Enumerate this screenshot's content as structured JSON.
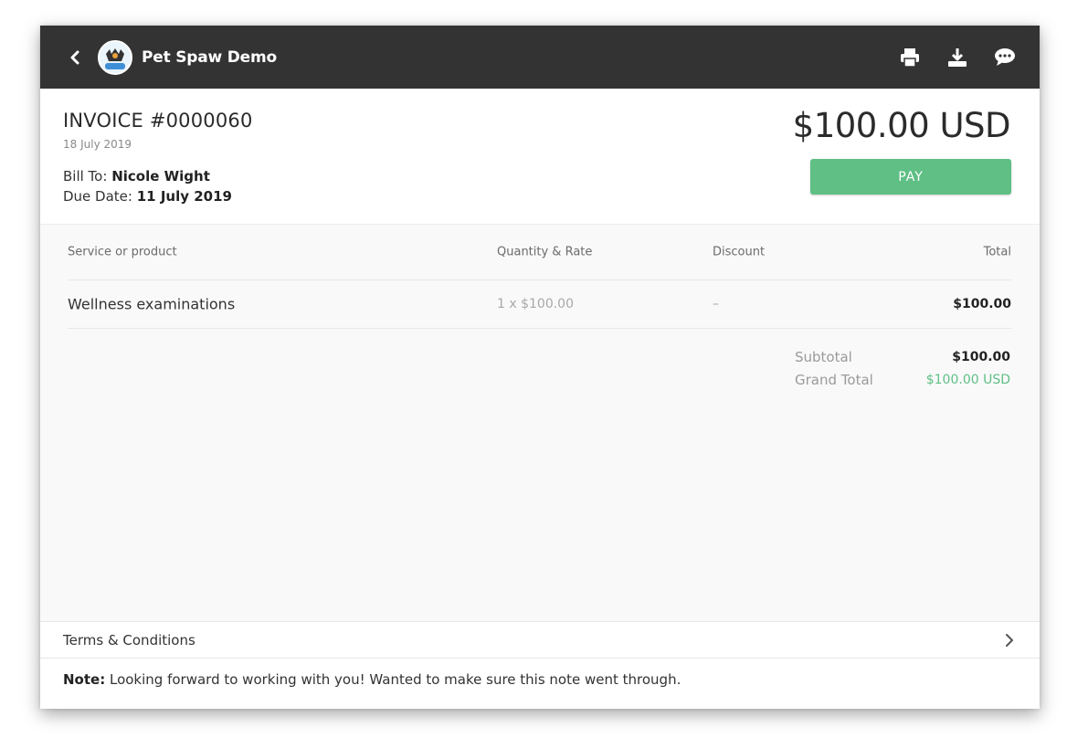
{
  "topbar": {
    "title": "Pet Spaw Demo",
    "icons": [
      "back-icon",
      "logo",
      "print-icon",
      "download-icon",
      "chat-icon"
    ]
  },
  "invoice": {
    "title": "INVOICE #0000060",
    "date": "18 July 2019",
    "bill_to_label": "Bill To:",
    "bill_to_name": "Nicole Wight",
    "due_date_label": "Due Date:",
    "due_date": "11 July 2019",
    "amount": "$100.00 USD",
    "pay_label": "PAY"
  },
  "table": {
    "headers": [
      "Service or product",
      "Quantity & Rate",
      "Discount",
      "Total"
    ],
    "rows": [
      {
        "service": "Wellness examinations",
        "qty_rate": "1 x $100.00",
        "discount": "–",
        "total": "$100.00"
      }
    ]
  },
  "totals": {
    "subtotal_label": "Subtotal",
    "subtotal": "$100.00",
    "grand_total_label": "Grand Total",
    "grand_total": "$100.00 USD"
  },
  "terms": {
    "label": "Terms & Conditions"
  },
  "note": {
    "label": "Note:",
    "text": "Looking forward to working with you! Wanted to make sure this note went through."
  },
  "colors": {
    "topbar": "#333333",
    "accent_green": "#5fbf85"
  }
}
